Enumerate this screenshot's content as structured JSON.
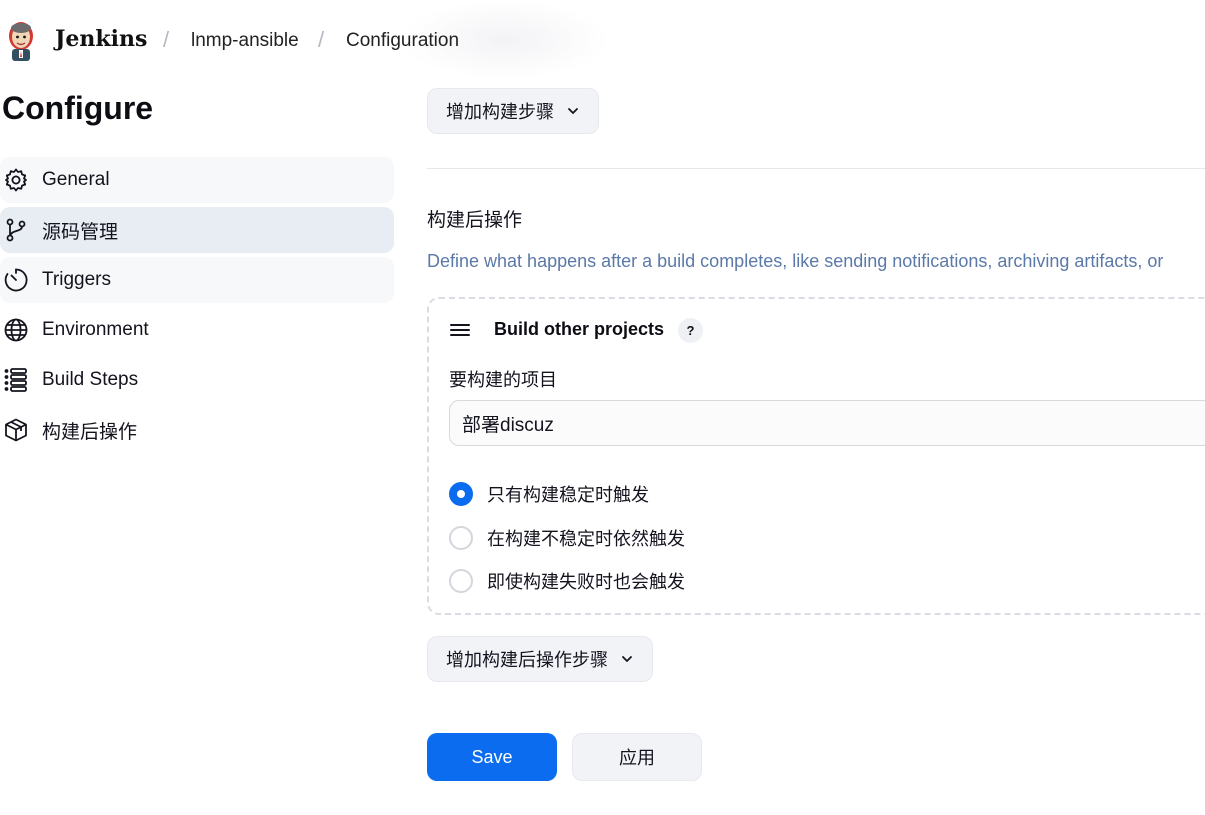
{
  "header": {
    "brand": "Jenkins",
    "breadcrumbs": [
      "lnmp-ansible",
      "Configuration"
    ],
    "separator": "/"
  },
  "sidebar": {
    "title": "Configure",
    "items": [
      {
        "label": "General",
        "icon": "gear-icon"
      },
      {
        "label": "源码管理",
        "icon": "branch-icon"
      },
      {
        "label": "Triggers",
        "icon": "timer-icon"
      },
      {
        "label": "Environment",
        "icon": "globe-icon"
      },
      {
        "label": "Build Steps",
        "icon": "list-icon"
      },
      {
        "label": "构建后操作",
        "icon": "package-icon"
      }
    ],
    "active_index": 1
  },
  "main": {
    "add_build_step_label": "增加构建步骤",
    "post_build": {
      "title": "构建后操作",
      "description": "Define what happens after a build completes, like sending notifications, archiving artifacts, or"
    },
    "card": {
      "title": "Build other projects",
      "help": "?",
      "field_label": "要构建的项目",
      "field_value": "部署discuz",
      "options": [
        {
          "label": "只有构建稳定时触发",
          "checked": true
        },
        {
          "label": "在构建不稳定时依然触发",
          "checked": false
        },
        {
          "label": "即使构建失败时也会触发",
          "checked": false
        }
      ]
    },
    "add_post_build_step_label": "增加构建后操作步骤",
    "save_label": "Save",
    "apply_label": "应用"
  },
  "colors": {
    "accent": "#0b6cf0",
    "active_bg": "#e8ecf3",
    "description": "#5b79a8"
  }
}
